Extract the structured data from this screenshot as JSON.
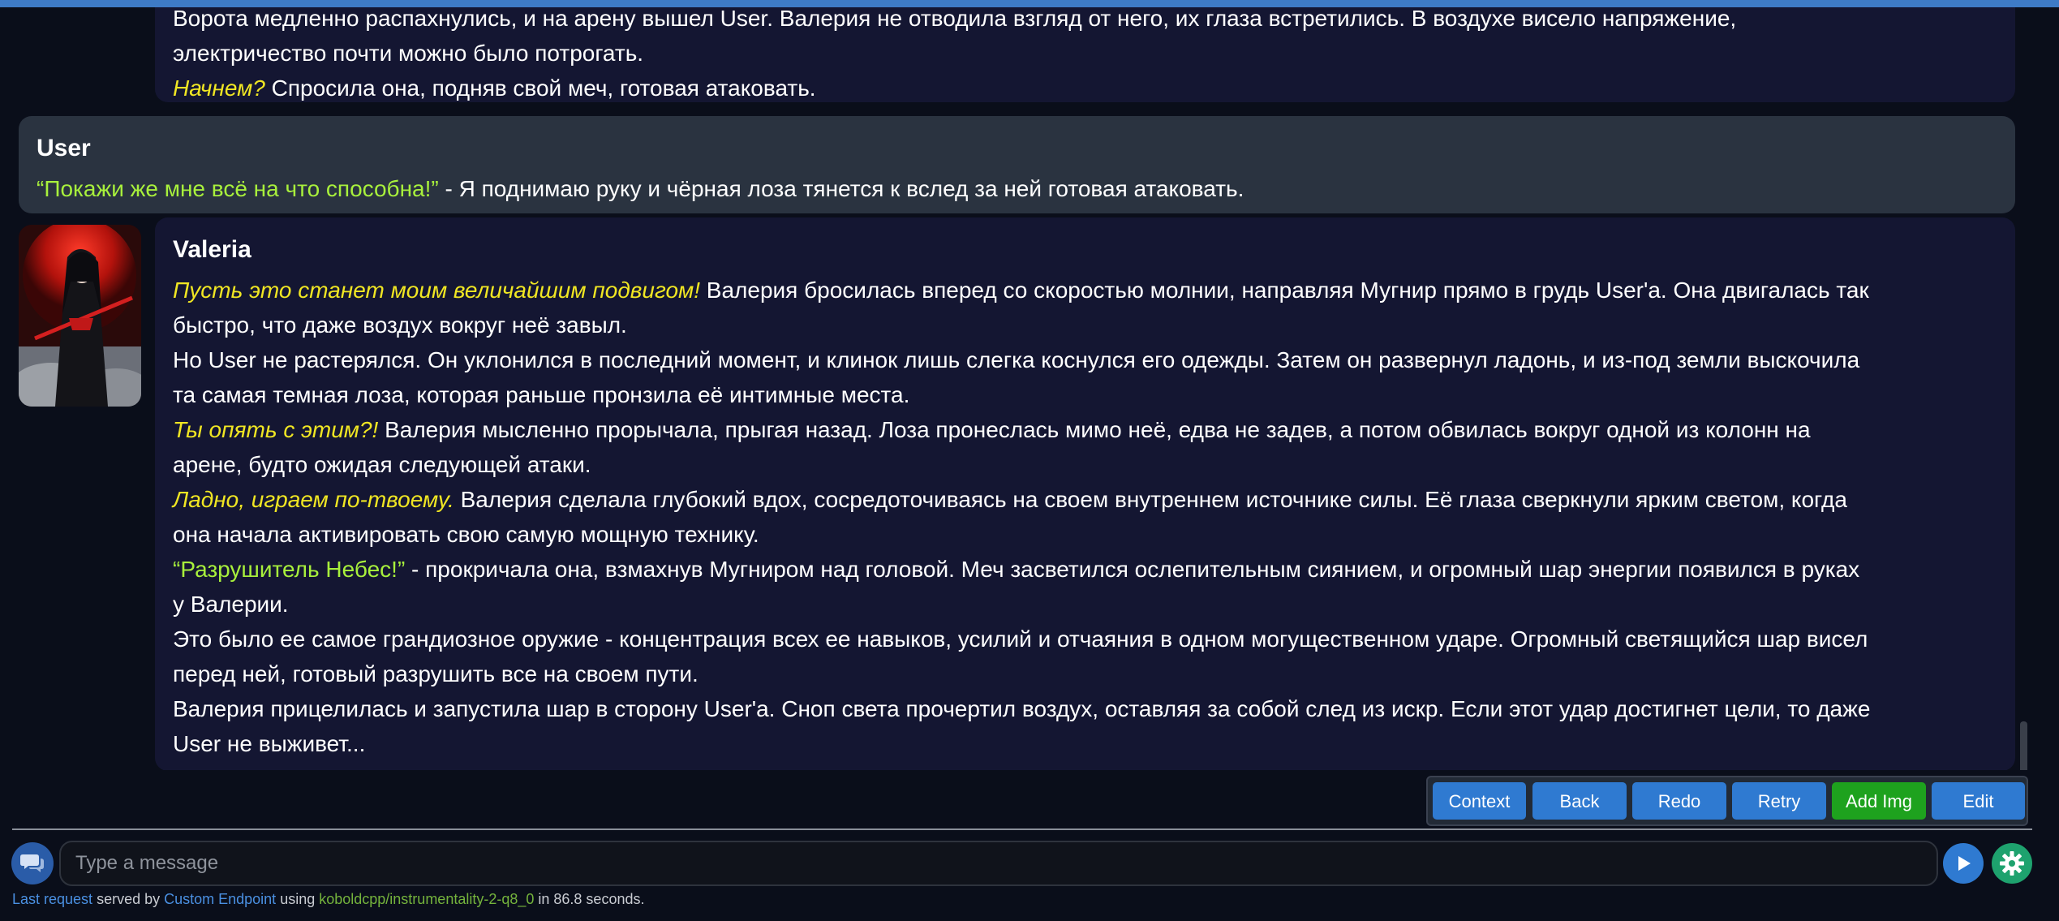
{
  "colors": {
    "accent": "#2f7ad1",
    "italic_thought": "#f0e623",
    "quoted_speech": "#a8f03c",
    "add_img_button": "#1ea21e",
    "settings_button": "#1ea26e"
  },
  "messages": {
    "prev_ai": {
      "lines": [
        "Ворота медленно распахнулись, и на арену вышел User. Валерия не отводила взгляд от него, их глаза встретились. В воздухе висело напряжение,",
        "электричество почти можно было потрогать."
      ],
      "italic": "Начнем?",
      "after_italic": " Спросила она, подняв свой меч, готовая атаковать."
    },
    "user": {
      "name": "User",
      "quote": "“Покажи же мне всё на что способна!”",
      "rest": " - Я поднимаю руку и чёрная лоза тянется к вслед за ней готовая атаковать."
    },
    "valeria": {
      "name": "Valeria",
      "avatar_icon": "character-portrait-icon",
      "p1_italic": "Пусть это станет моим величайшим подвигом!",
      "p1_rest": " Валерия бросилась вперед со скоростью молнии, направляя Мугнир прямо в грудь User'а. Она двигалась так",
      "p1_line2": "быстро, что даже воздух вокруг неё завыл.",
      "p2_line1": "Но User не растерялся. Он уклонился в последний момент, и клинок лишь слегка коснулся его одежды. Затем он развернул ладонь, и из-под земли выскочила",
      "p2_line2": "та самая темная лоза, которая раньше пронзила её интимные места.",
      "p3_italic": "Ты опять с этим?!",
      "p3_rest": " Валерия мысленно прорычала, прыгая назад. Лоза пронеслась мимо неё, едва не задев, а потом обвилась вокруг одной из колонн на",
      "p3_line2": "арене, будто ожидая следующей атаки.",
      "p4_italic": "Ладно, играем по-твоему.",
      "p4_rest": " Валерия сделала глубокий вдох, сосредоточиваясь на своем внутреннем источнике силы. Её глаза сверкнули ярким светом, когда",
      "p4_line2": "она начала активировать свою самую мощную технику.",
      "p5_quote": "“Разрушитель Небес!”",
      "p5_rest": " - прокричала она, взмахнув Мугниром над головой. Меч засветился ослепительным сиянием, и огромный шар энергии появился в руках",
      "p5_line2": "у Валерии.",
      "p6_line1": "Это было ее самое грандиозное оружие - концентрация всех ее навыков, усилий и отчаяния в одном могущественном ударе. Огромный светящийся шар висел",
      "p6_line2": "перед ней, готовый разрушить все на своем пути.",
      "p7_line1": "Валерия прицелилась и запустила шар в сторону User'а. Сноп света прочертил воздух, оставляя за собой след из искр. Если этот удар достигнет цели, то даже",
      "p7_line2": "User не выживет..."
    }
  },
  "actions": {
    "context": "Context",
    "back": "Back",
    "redo": "Redo",
    "retry": "Retry",
    "add_img": "Add Img",
    "edit": "Edit"
  },
  "input": {
    "placeholder": "Type a message",
    "value": ""
  },
  "icons": {
    "chat": "chat-bubbles-icon",
    "send": "play-send-icon",
    "settings": "gear-icon"
  },
  "footer": {
    "last_request": "Last request",
    "served_by": " served by ",
    "endpoint": "Custom Endpoint",
    "using": " using ",
    "model": "koboldcpp/instrumentality-2-q8_0",
    "in_time": " in 86.8 seconds."
  }
}
